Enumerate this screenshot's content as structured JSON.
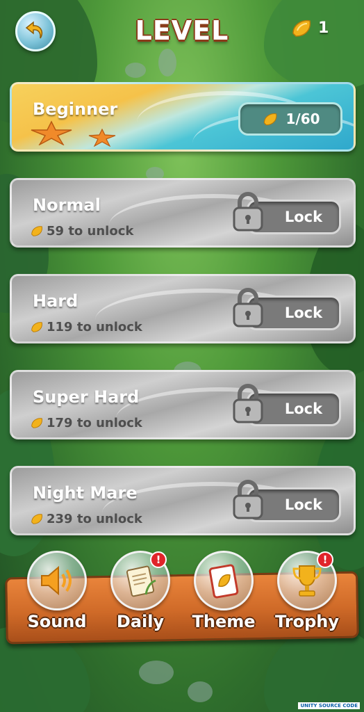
{
  "header": {
    "title": "LEVEL",
    "gem_count": "1"
  },
  "levels": [
    {
      "name": "Beginner",
      "progress": "1/60",
      "state": "unlocked",
      "stars": 2
    },
    {
      "name": "Normal",
      "unlock_cost": "59 to unlock",
      "button": "Lock",
      "state": "locked"
    },
    {
      "name": "Hard",
      "unlock_cost": "119 to unlock",
      "button": "Lock",
      "state": "locked"
    },
    {
      "name": "Super Hard",
      "unlock_cost": "179 to unlock",
      "button": "Lock",
      "state": "locked"
    },
    {
      "name": "Night Mare",
      "unlock_cost": "239 to unlock",
      "button": "Lock",
      "state": "locked"
    }
  ],
  "menu": {
    "sound": "Sound",
    "daily": "Daily",
    "theme": "Theme",
    "trophy": "Trophy",
    "badge": "!"
  },
  "colors": {
    "title_outline": "#8a3b1a",
    "board": "#cf6a28",
    "gem": "#f2b21c",
    "alert": "#e0242a"
  },
  "icons": [
    "back-arrow-icon",
    "gem-icon",
    "starfish-icon",
    "padlock-icon",
    "speaker-icon",
    "calendar-note-icon",
    "card-theme-icon",
    "trophy-icon"
  ],
  "watermark": "UNITY SOURCE CODE"
}
